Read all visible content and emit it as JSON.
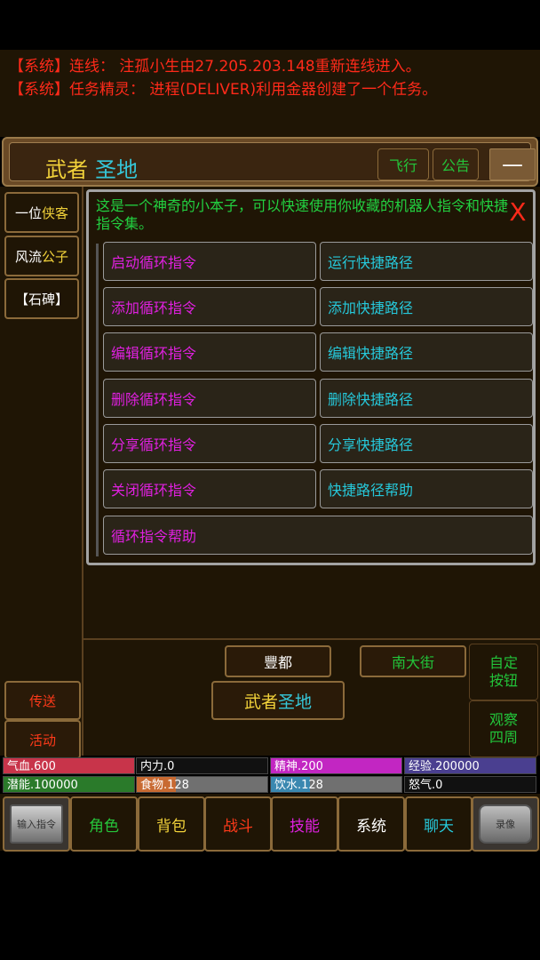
{
  "log": [
    "【系统】连线： 注孤小生由27.205.203.148重新连线进入。",
    "【系统】任务精灵： 进程(DELIVER)利用金器创建了一个任务。"
  ],
  "title": {
    "left": "武者",
    "right": "圣地"
  },
  "title_buttons": {
    "fly": "飞行",
    "notice": "公告",
    "minimize": "—"
  },
  "side_buttons": [
    {
      "pre": "一位",
      "hl": "侠客"
    },
    {
      "pre": "风流",
      "hl": "公子"
    },
    {
      "pre": "【石碑】",
      "hl": ""
    }
  ],
  "action_buttons": {
    "teleport": "传送",
    "activity": "活动"
  },
  "dialog": {
    "message": "这是一个神奇的小本子，可以快速使用你收藏的机器人指令和快捷指令集。",
    "close": "X",
    "left_commands": [
      "启动循环指令",
      "添加循环指令",
      "编辑循环指令",
      "删除循环指令",
      "分享循环指令",
      "关闭循环指令"
    ],
    "right_commands": [
      "运行快捷路径",
      "添加快捷路径",
      "编辑快捷路径",
      "删除快捷路径",
      "分享快捷路径",
      "快捷路径帮助"
    ],
    "wide_command": "循环指令帮助"
  },
  "exits": {
    "north": "豐都",
    "east": "南大街"
  },
  "current_location": {
    "left": "武者",
    "right": "圣地"
  },
  "right_side": {
    "custom": "自定\n按钮",
    "observe": "观察\n四周"
  },
  "stats": [
    {
      "label": "气血.600",
      "color": "#c8344a",
      "fill": 1
    },
    {
      "label": "内力.0",
      "color": "#333333",
      "fill": 0
    },
    {
      "label": "精神.200",
      "color": "#c226c2",
      "fill": 1
    },
    {
      "label": "经验.200000",
      "color": "#4a3f90",
      "fill": 1
    },
    {
      "label": "潜能.100000",
      "color": "#2a7a2a",
      "fill": 1
    },
    {
      "label": "食物.128",
      "color": "#c86a32",
      "fill": 0.3
    },
    {
      "label": "饮水.128",
      "color": "#3a88b0",
      "fill": 0.3
    },
    {
      "label": "怒气.0",
      "color": "#333333",
      "fill": 0
    }
  ],
  "toolbar": {
    "input": "输入指令",
    "items": [
      {
        "label": "角色",
        "color": "#26c43a"
      },
      {
        "label": "背包",
        "color": "#f2d23a"
      },
      {
        "label": "战斗",
        "color": "#ff3a1a"
      },
      {
        "label": "技能",
        "color": "#e020e0"
      },
      {
        "label": "系统",
        "color": "#ffffff"
      },
      {
        "label": "聊天",
        "color": "#26c8da"
      }
    ],
    "record": "录像"
  }
}
